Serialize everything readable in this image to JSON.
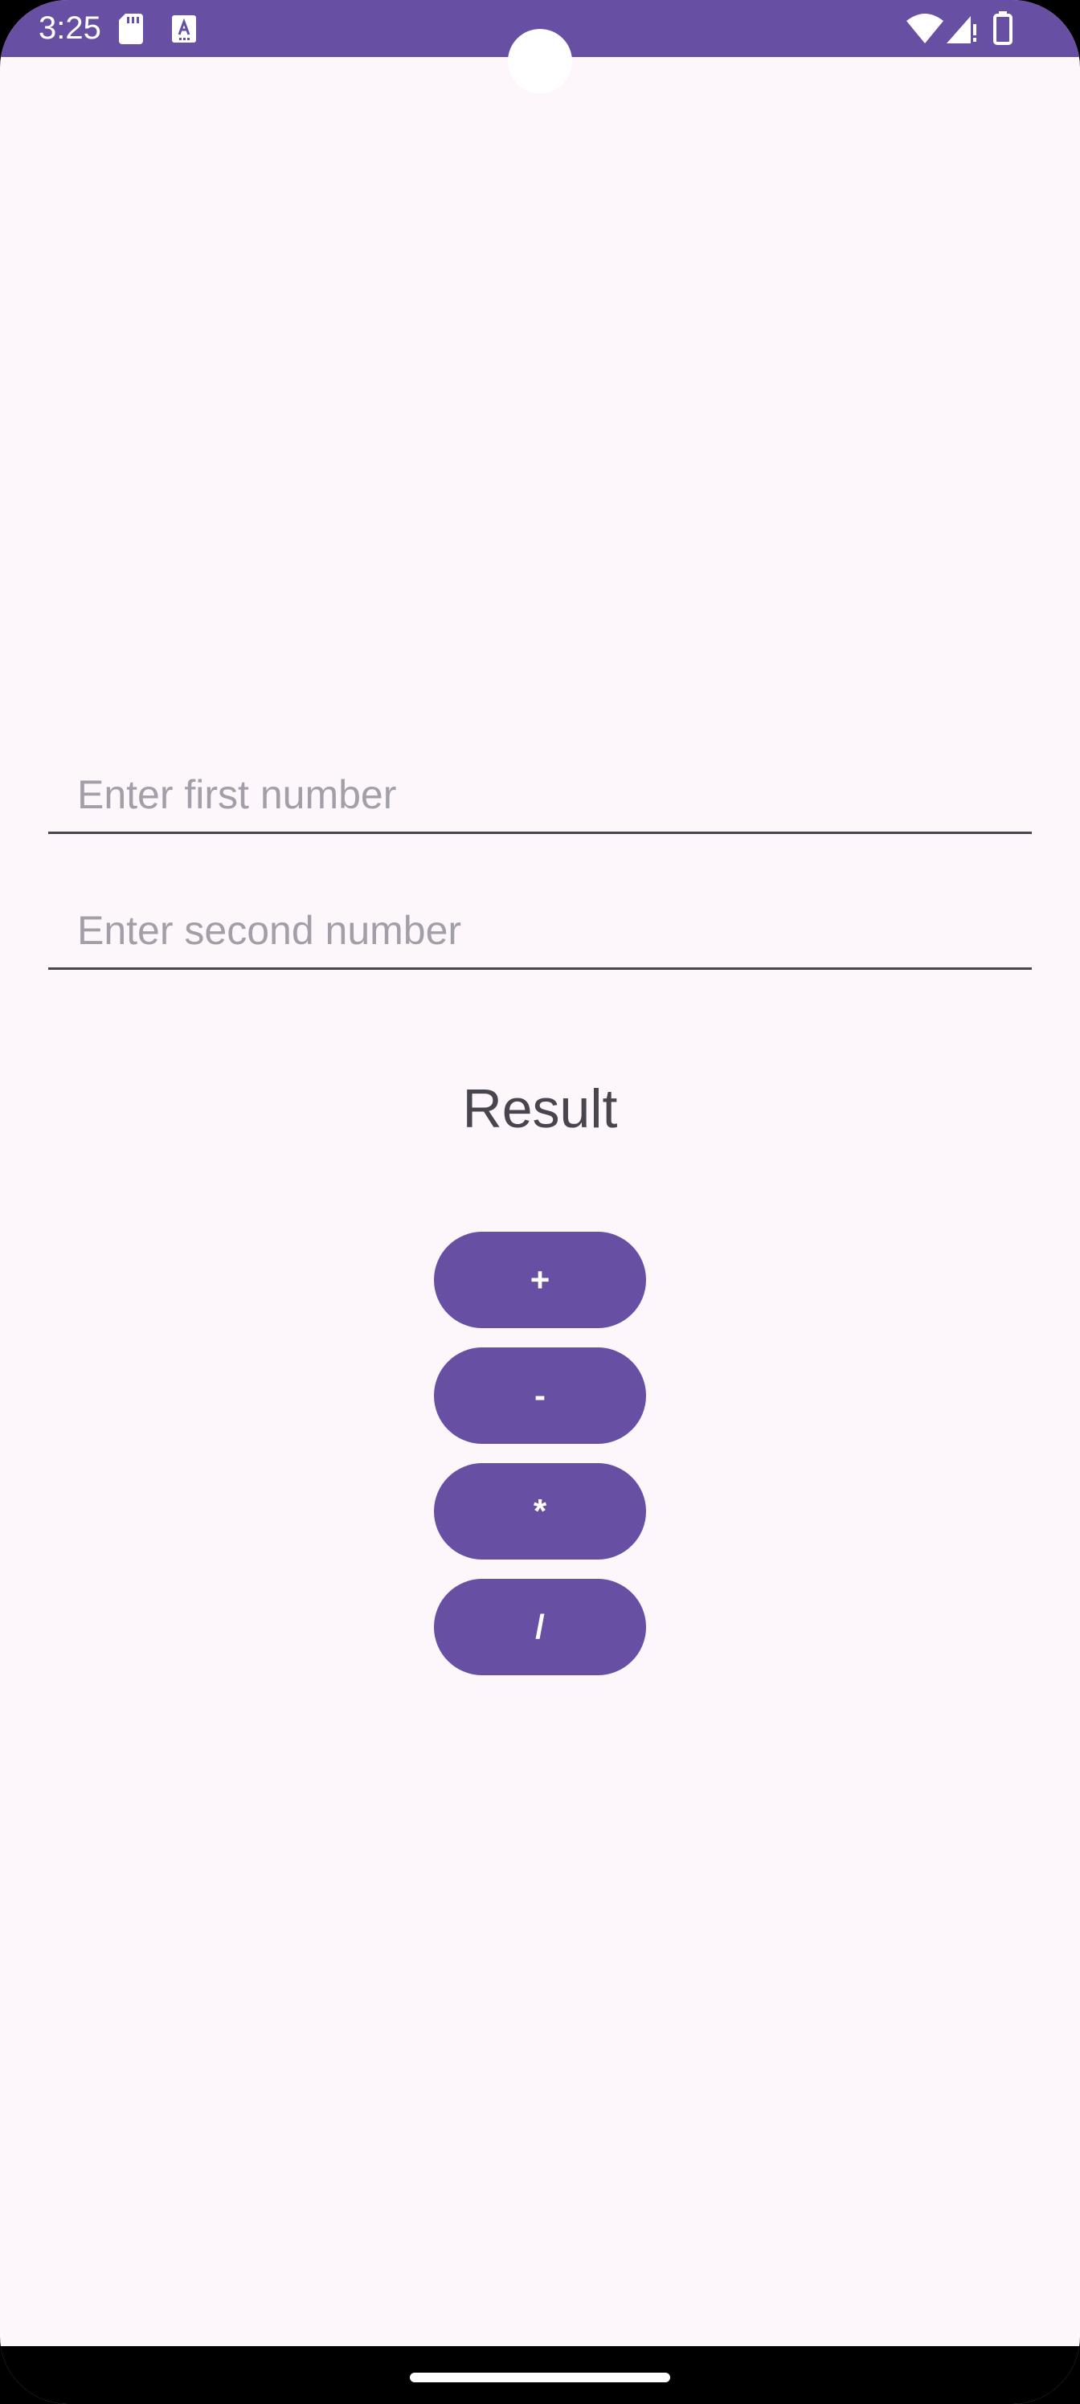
{
  "status_bar": {
    "time": "3:25",
    "icons": [
      "sd-card-icon",
      "font-a-icon",
      "wifi-icon",
      "signal-icon",
      "battery-icon"
    ],
    "background": "#6750A4"
  },
  "form": {
    "first_number": {
      "value": "",
      "placeholder": "Enter first number"
    },
    "second_number": {
      "value": "",
      "placeholder": "Enter second number"
    }
  },
  "result": {
    "label": "Result"
  },
  "operations": [
    {
      "label": "+"
    },
    {
      "label": "-"
    },
    {
      "label": "*"
    },
    {
      "label": "/"
    }
  ],
  "colors": {
    "accent": "#6750A4",
    "background": "#FDF6FB",
    "text": "#49454F",
    "placeholder": "#A39FA8"
  }
}
